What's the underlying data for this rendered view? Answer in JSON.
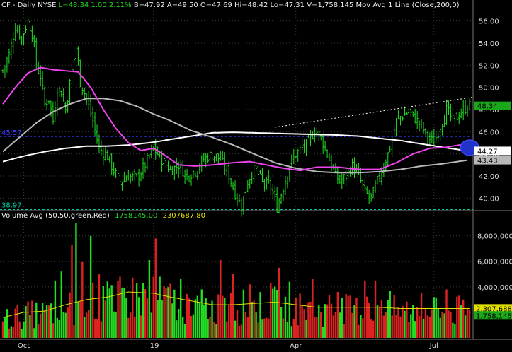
{
  "header": {
    "symbol": "CF - Daily  NYSE",
    "last": "L=48.34",
    "change": "1.00",
    "change_pct": "2.11%",
    "bid": "B=47.92",
    "ask": "A=49.50",
    "open": "O=47.69",
    "high": "Hi=48.42",
    "low": "Lo=47.31",
    "volume": "V=1,758,145",
    "study": "Mov Avg 1 Line (Close,200,0)"
  },
  "volume_header": {
    "label": "Volume Avg (50,50,green,Red)",
    "value": "1758145.00",
    "avg": "2307687.80"
  },
  "colors": {
    "background": "#000000",
    "grid": "#3a3a3a",
    "up": "#22dd22",
    "down": "#dd2222",
    "ma_magenta": "#ee44ee",
    "ma_gray": "#b8b8b8",
    "ma_white": "#ffffff",
    "volume_avg": "#e0e000",
    "ref_line_blue": "#3a3aff",
    "ref_line_green": "#00c8a0",
    "circle": "#2233cc",
    "axis_text": "#dddddd"
  },
  "chart_data": [
    {
      "type": "candlestick-ohlc",
      "price_axis": {
        "ticks": [
          40,
          42,
          44,
          46,
          48,
          50,
          52,
          54,
          56
        ],
        "tick_labels": [
          "40.00",
          "42.00",
          "44.00",
          "46.00",
          "48.00",
          "50.00",
          "52.00",
          "54.00",
          "56.00"
        ],
        "range": [
          39,
          57
        ]
      },
      "x_axis": {
        "labels": [
          "Oct",
          "'19",
          "Apr",
          "Jul"
        ],
        "label_index": [
          10,
          72,
          140,
          206
        ]
      },
      "price_labels": {
        "last": "48.34",
        "ma_white": "44.27",
        "ma_gray": "43.43",
        "ref_blue": "45.57",
        "ref_green": "38.97"
      },
      "ref_lines": [
        {
          "value": 45.57,
          "color": "blue",
          "style": "dashed"
        },
        {
          "value": 38.97,
          "color": "green",
          "style": "dashed"
        }
      ],
      "trendline": {
        "from": [
          130,
          46.4
        ],
        "to": [
          224,
          49.1
        ]
      },
      "close_anchors": [
        [
          0,
          51.5
        ],
        [
          3,
          53.0
        ],
        [
          6,
          55.5
        ],
        [
          9,
          54.5
        ],
        [
          12,
          56.0
        ],
        [
          14,
          55.0
        ],
        [
          16,
          52.0
        ],
        [
          18,
          51.0
        ],
        [
          20,
          48.5
        ],
        [
          22,
          49.0
        ],
        [
          24,
          47.0
        ],
        [
          26,
          50.0
        ],
        [
          28,
          49.5
        ],
        [
          30,
          48.0
        ],
        [
          33,
          51.5
        ],
        [
          35,
          53.5
        ],
        [
          37,
          50.5
        ],
        [
          40,
          49.0
        ],
        [
          43,
          47.0
        ],
        [
          46,
          44.5
        ],
        [
          50,
          43.8
        ],
        [
          53,
          42.5
        ],
        [
          56,
          41.5
        ],
        [
          60,
          42.0
        ],
        [
          64,
          41.8
        ],
        [
          68,
          43.0
        ],
        [
          72,
          44.5
        ],
        [
          76,
          43.5
        ],
        [
          80,
          42.5
        ],
        [
          84,
          43.0
        ],
        [
          88,
          42.0
        ],
        [
          92,
          42.5
        ],
        [
          96,
          43.5
        ],
        [
          100,
          44.0
        ],
        [
          104,
          43.5
        ],
        [
          108,
          42.0
        ],
        [
          112,
          40.0
        ],
        [
          114,
          39.3
        ],
        [
          117,
          41.5
        ],
        [
          120,
          42.8
        ],
        [
          124,
          41.5
        ],
        [
          128,
          41.0
        ],
        [
          131,
          39.2
        ],
        [
          134,
          41.0
        ],
        [
          137,
          43.0
        ],
        [
          140,
          44.0
        ],
        [
          143,
          44.5
        ],
        [
          146,
          45.0
        ],
        [
          149,
          46.2
        ],
        [
          152,
          45.5
        ],
        [
          155,
          44.0
        ],
        [
          158,
          42.5
        ],
        [
          161,
          41.5
        ],
        [
          164,
          42.0
        ],
        [
          167,
          43.0
        ],
        [
          170,
          42.0
        ],
        [
          173,
          40.5
        ],
        [
          176,
          40.0
        ],
        [
          179,
          41.5
        ],
        [
          182,
          43.0
        ],
        [
          185,
          44.5
        ],
        [
          188,
          47.0
        ],
        [
          191,
          47.5
        ],
        [
          194,
          47.8
        ],
        [
          197,
          47.2
        ],
        [
          200,
          46.5
        ],
        [
          203,
          45.5
        ],
        [
          206,
          45.0
        ],
        [
          209,
          46.5
        ],
        [
          212,
          48.0
        ],
        [
          215,
          47.0
        ],
        [
          218,
          47.5
        ],
        [
          222,
          48.34
        ]
      ],
      "ma_magenta_anchors": [
        [
          0,
          48.5
        ],
        [
          6,
          50.0
        ],
        [
          12,
          51.3
        ],
        [
          18,
          51.8
        ],
        [
          24,
          51.6
        ],
        [
          30,
          51.5
        ],
        [
          36,
          51.4
        ],
        [
          42,
          50.0
        ],
        [
          48,
          48.0
        ],
        [
          54,
          46.3
        ],
        [
          60,
          45.0
        ],
        [
          66,
          44.3
        ],
        [
          72,
          44.5
        ],
        [
          78,
          43.8
        ],
        [
          84,
          43.0
        ],
        [
          92,
          42.9
        ],
        [
          100,
          43.0
        ],
        [
          110,
          43.2
        ],
        [
          118,
          43.3
        ],
        [
          126,
          43.0
        ],
        [
          134,
          42.7
        ],
        [
          142,
          42.5
        ],
        [
          150,
          42.8
        ],
        [
          160,
          42.8
        ],
        [
          170,
          42.6
        ],
        [
          180,
          42.6
        ],
        [
          188,
          43.2
        ],
        [
          196,
          44.0
        ],
        [
          204,
          44.5
        ],
        [
          212,
          44.6
        ],
        [
          218,
          44.8
        ],
        [
          222,
          44.8
        ]
      ],
      "ma_gray_anchors": [
        [
          0,
          44.2
        ],
        [
          8,
          45.5
        ],
        [
          16,
          46.8
        ],
        [
          24,
          47.8
        ],
        [
          32,
          48.5
        ],
        [
          40,
          49.0
        ],
        [
          48,
          49.0
        ],
        [
          56,
          48.8
        ],
        [
          64,
          48.3
        ],
        [
          72,
          47.6
        ],
        [
          80,
          47.0
        ],
        [
          90,
          46.1
        ],
        [
          100,
          45.5
        ],
        [
          110,
          44.8
        ],
        [
          120,
          44.0
        ],
        [
          130,
          43.2
        ],
        [
          140,
          42.7
        ],
        [
          150,
          42.4
        ],
        [
          160,
          42.3
        ],
        [
          170,
          42.3
        ],
        [
          180,
          42.4
        ],
        [
          190,
          42.6
        ],
        [
          200,
          42.9
        ],
        [
          210,
          43.1
        ],
        [
          222,
          43.43
        ]
      ],
      "ma_white_anchors": [
        [
          0,
          43.3
        ],
        [
          10,
          43.8
        ],
        [
          20,
          44.2
        ],
        [
          30,
          44.5
        ],
        [
          40,
          44.7
        ],
        [
          50,
          44.7
        ],
        [
          60,
          44.8
        ],
        [
          70,
          45.0
        ],
        [
          80,
          45.3
        ],
        [
          90,
          45.6
        ],
        [
          100,
          45.9
        ],
        [
          110,
          45.95
        ],
        [
          120,
          45.9
        ],
        [
          130,
          45.85
        ],
        [
          140,
          45.8
        ],
        [
          150,
          45.75
        ],
        [
          160,
          45.7
        ],
        [
          170,
          45.6
        ],
        [
          180,
          45.4
        ],
        [
          190,
          45.2
        ],
        [
          200,
          44.9
        ],
        [
          210,
          44.6
        ],
        [
          222,
          44.27
        ]
      ],
      "marker_circle": {
        "index": 221,
        "value": 44.5
      }
    },
    {
      "type": "bar",
      "title": "Volume Avg (50,50,green,Red)",
      "y_axis": {
        "ticks": [
          2000000,
          4000000,
          6000000,
          8000000
        ],
        "tick_labels": [
          "",
          "4,000,000",
          "6,000,000",
          "8,000,000"
        ],
        "range": [
          0,
          9200000
        ]
      },
      "value_labels": {
        "avg": "2,307,688",
        "last": "1,758,145"
      },
      "volume_anchors": [
        [
          0,
          1.6
        ],
        [
          10,
          2.0
        ],
        [
          20,
          2.1
        ],
        [
          30,
          2.6
        ],
        [
          40,
          3.0
        ],
        [
          50,
          3.2
        ],
        [
          60,
          3.6
        ],
        [
          72,
          3.5
        ],
        [
          80,
          3.2
        ],
        [
          90,
          2.9
        ],
        [
          100,
          2.6
        ],
        [
          110,
          2.6
        ],
        [
          120,
          2.7
        ],
        [
          130,
          2.8
        ],
        [
          140,
          2.6
        ],
        [
          150,
          2.4
        ],
        [
          160,
          2.4
        ],
        [
          170,
          2.4
        ],
        [
          180,
          2.4
        ],
        [
          190,
          2.3
        ],
        [
          200,
          2.3
        ],
        [
          210,
          2.3
        ],
        [
          222,
          2.3
        ]
      ],
      "volume_spikes": [
        [
          25,
          4.5
        ],
        [
          28,
          5.2
        ],
        [
          33,
          7.3
        ],
        [
          35,
          9.0
        ],
        [
          38,
          6.0
        ],
        [
          42,
          8.0
        ],
        [
          46,
          5.0
        ],
        [
          55,
          4.5
        ],
        [
          70,
          6.1
        ],
        [
          73,
          7.8
        ],
        [
          85,
          4.6
        ],
        [
          95,
          3.8
        ],
        [
          104,
          6.1
        ],
        [
          110,
          5.0
        ],
        [
          118,
          4.2
        ],
        [
          128,
          4.3
        ],
        [
          132,
          5.5
        ],
        [
          137,
          4.4
        ],
        [
          148,
          4.6
        ],
        [
          160,
          3.6
        ],
        [
          173,
          4.5
        ],
        [
          178,
          4.5
        ],
        [
          185,
          3.7
        ],
        [
          200,
          3.5
        ],
        [
          206,
          3.2
        ],
        [
          212,
          3.8
        ]
      ]
    }
  ]
}
